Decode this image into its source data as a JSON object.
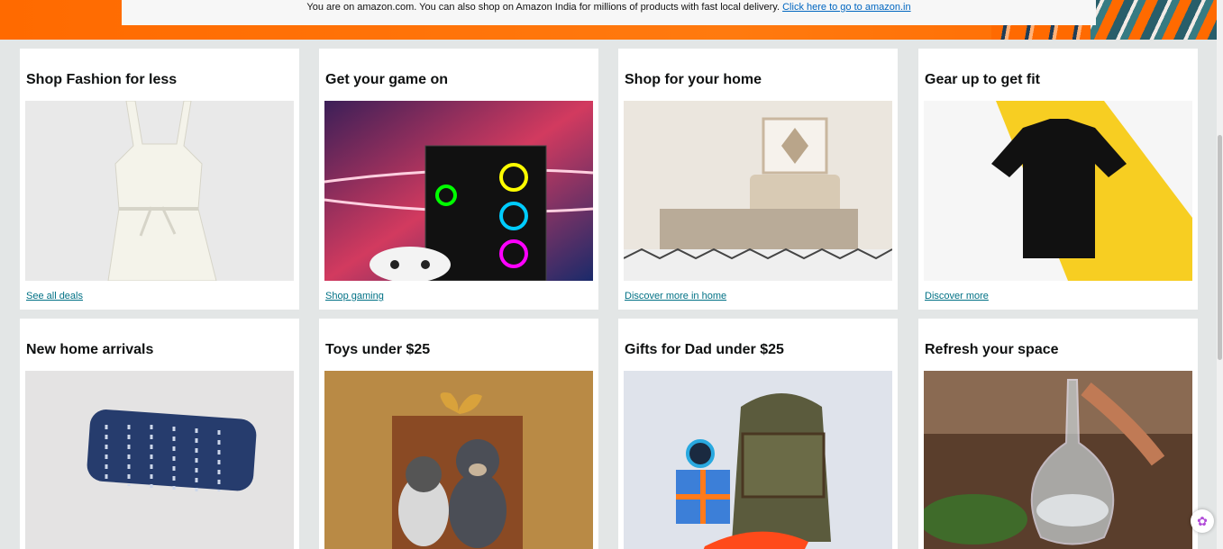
{
  "notice": {
    "text": "You are on amazon.com. You can also shop on Amazon India for millions of products with fast local delivery. ",
    "link": "Click here to go to amazon.in"
  },
  "cards": [
    {
      "title": "Shop Fashion for less",
      "link": "See all deals",
      "image": "white-dress-image"
    },
    {
      "title": "Get your game on",
      "link": "Shop gaming",
      "image": "gaming-pc-image"
    },
    {
      "title": "Shop for your home",
      "link": "Discover more in home",
      "image": "bedroom-image"
    },
    {
      "title": "Gear up to get fit",
      "link": "Discover more",
      "image": "black-tshirt-image"
    },
    {
      "title": "New home arrivals",
      "image": "blue-pillow-image"
    },
    {
      "title": "Toys under $25",
      "image": "plush-toys-gift-box-image"
    },
    {
      "title": "Gifts for Dad under $25",
      "image": "backpack-gifts-image"
    },
    {
      "title": "Refresh your space",
      "image": "glass-carafe-dinner-image"
    }
  ],
  "colors": {
    "accent": "#ff6a00",
    "link": "#007185",
    "page_bg": "#e3e6e6"
  }
}
